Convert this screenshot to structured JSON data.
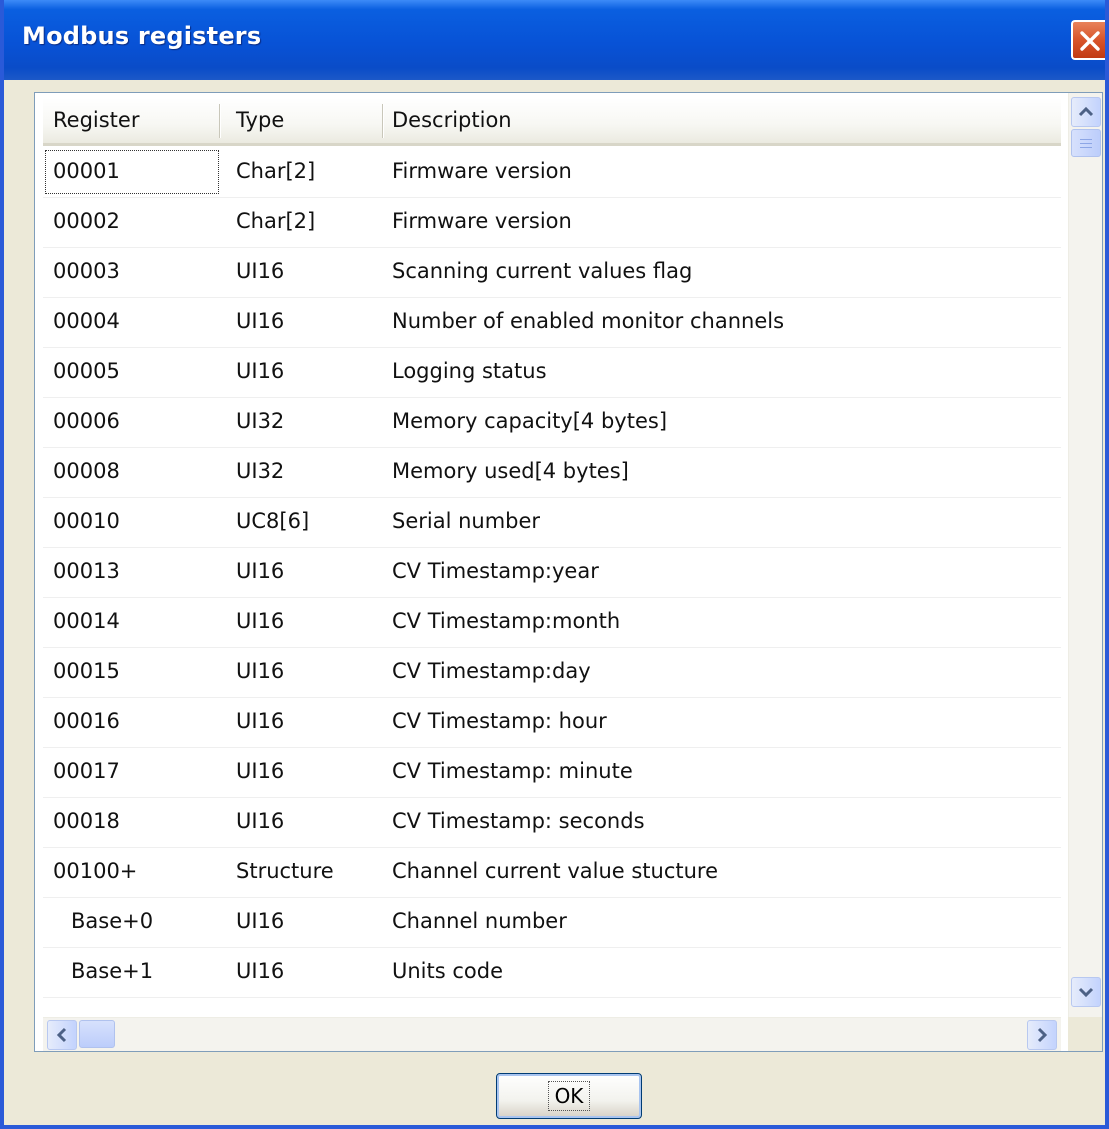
{
  "window": {
    "title": "Modbus registers"
  },
  "table": {
    "columns": [
      "Register",
      "Type",
      "Description"
    ],
    "rows": [
      {
        "register": "00001",
        "type": "Char[2]",
        "description": "Firmware version"
      },
      {
        "register": "00002",
        "type": "Char[2]",
        "description": "Firmware version"
      },
      {
        "register": "00003",
        "type": "UI16",
        "description": "Scanning current values flag"
      },
      {
        "register": "00004",
        "type": "UI16",
        "description": "Number of enabled monitor channels"
      },
      {
        "register": "00005",
        "type": "UI16",
        "description": "Logging status"
      },
      {
        "register": "00006",
        "type": "UI32",
        "description": "Memory capacity[4 bytes]"
      },
      {
        "register": "00008",
        "type": "UI32",
        "description": "Memory used[4 bytes]"
      },
      {
        "register": "00010",
        "type": "UC8[6]",
        "description": "Serial number"
      },
      {
        "register": "00013",
        "type": "UI16",
        "description": "CV Timestamp:year"
      },
      {
        "register": "00014",
        "type": "UI16",
        "description": "CV Timestamp:month"
      },
      {
        "register": "00015",
        "type": "UI16",
        "description": "CV Timestamp:day"
      },
      {
        "register": "00016",
        "type": "UI16",
        "description": "CV Timestamp: hour"
      },
      {
        "register": "00017",
        "type": "UI16",
        "description": "CV Timestamp: minute"
      },
      {
        "register": "00018",
        "type": "UI16",
        "description": "CV Timestamp: seconds"
      },
      {
        "register": "00100+",
        "type": "Structure",
        "description": "Channel current value stucture"
      },
      {
        "register": "Base+0",
        "type": "UI16",
        "description": "Channel number"
      },
      {
        "register": "Base+1",
        "type": "UI16",
        "description": "Units code"
      }
    ]
  },
  "buttons": {
    "ok_label": "OK"
  },
  "icons": {
    "close": "close-icon",
    "scroll_up": "arrow-up-icon",
    "scroll_down": "arrow-down-icon",
    "scroll_left": "arrow-left-icon",
    "scroll_right": "arrow-right-icon"
  },
  "colors": {
    "titlebar": "#0852d6",
    "close_button": "#d8542a",
    "dialog_face": "#ece9d8"
  }
}
